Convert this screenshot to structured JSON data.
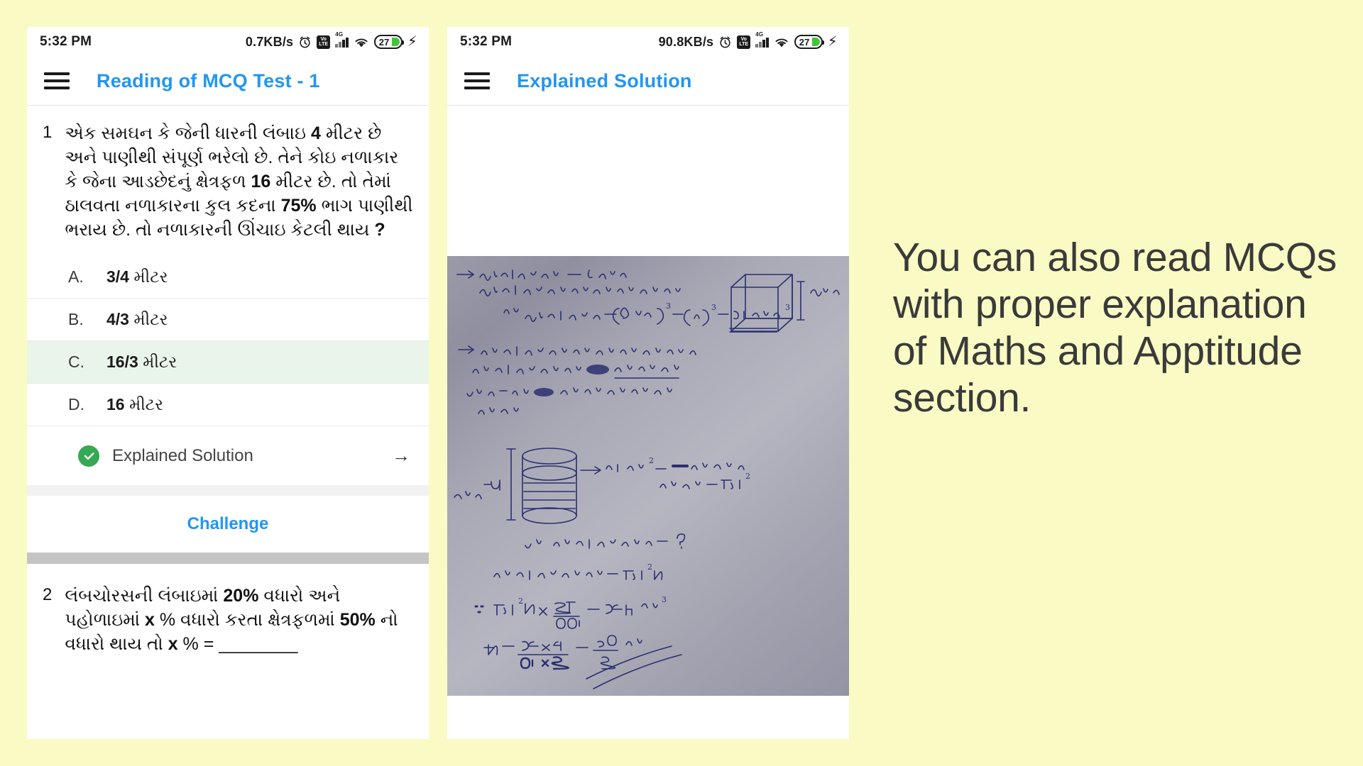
{
  "background_color": "#FAFAC4",
  "accent_color": "#2196F3",
  "correct_color": "#34A853",
  "marketing": {
    "text": "You can also read MCQs with proper explanation of Maths and Apptitude section."
  },
  "phone_left": {
    "status_bar": {
      "time": "5:32 PM",
      "network_speed": "0.7KB/s",
      "icons": [
        "alarm-icon",
        "volte-icon",
        "signal-4g-icon",
        "wifi-icon",
        "battery-icon",
        "charging-bolt-icon"
      ],
      "volte_label_top": "Vo",
      "volte_label_bottom": "LTE",
      "network_type": "4G",
      "battery_percent": "27"
    },
    "app_bar": {
      "menu_icon": "hamburger-menu-icon",
      "title": "Reading of MCQ Test - 1"
    },
    "questions": [
      {
        "number": "1",
        "text_html": "એક સમઘન કે જેની ધારની લંબાઇ <b>4</b> મીટર છે અને પાણીથી સંપૂર્ણ ભરેલો છે. તેને કોઇ નળાકાર કે જેના આડછેદનું ક્ષેત્રફળ <b>16</b> મીટર છે. તો તેમાં ઠાલવતા નળાકારના કુલ કદના <b>75%</b> ભાગ પાણીથી ભરાય છે. તો નળાકારની ઊંચાઇ કેટલી થાય <b>?</b>",
        "options": [
          {
            "label": "A.",
            "value": "3/4",
            "unit": "મીટર",
            "correct": false
          },
          {
            "label": "B.",
            "value": "4/3",
            "unit": "મીટર",
            "correct": false
          },
          {
            "label": "C.",
            "value": "16/3",
            "unit": "મીટર",
            "correct": true
          },
          {
            "label": "D.",
            "value": "16",
            "unit": "મીટર",
            "correct": false
          }
        ],
        "solution_row": {
          "status_icon": "check-circle-icon",
          "label": "Explained Solution",
          "chevron_icon": "arrow-right-icon"
        },
        "challenge_label": "Challenge"
      },
      {
        "number": "2",
        "text_html": "લંબચોરસની લંબાઇમાં <b>20%</b> વધારો અને પહોળાઇમાં <b>x</b> % વધારો કરતા ક્ષેત્રફળમાં <b>50%</b> નો વધારો થાય તો <b>x</b> % = ________"
      }
    ]
  },
  "phone_right": {
    "status_bar": {
      "time": "5:32 PM",
      "network_speed": "90.8KB/s",
      "icons": [
        "alarm-icon",
        "volte-icon",
        "signal-4g-icon",
        "wifi-icon",
        "battery-icon",
        "charging-bolt-icon"
      ],
      "volte_label_top": "Vo",
      "volte_label_bottom": "LTE",
      "network_type": "4G",
      "battery_percent": "27"
    },
    "app_bar": {
      "menu_icon": "hamburger-menu-icon",
      "title": "Explained Solution"
    },
    "handwritten_solution": {
      "description": "Handwritten Gujarati maths working on grey paper",
      "lines": [
        "→ સમઘનની ધારની લંબાઇ = ૪ મીટર",
        "અને સમઘન માં સંપૂર્ણ પાણીથી ભરેલ છે,",
        "તો સમઘનનું ઘનફળ = (લંબાઇ)³ = (૪)³ = ૬૪ મીટર³",
        "→ હવે આ પાણીને એક નળાકાર આકારના પાત્રમાં",
        "ઠાલવવામાં આવે છે. તેમાં પાણી કુલ કદનાં",
        "75% જેટલું ભરાય છે અને બાકીનો ભાગ ખાલી રહે છે.",
        "→ 16 મી² = આડછેદનું ક્ષેત્રફળ = πr²",
        "તો નળાકારની ઊંચાઇ = ?",
        "નળાકારનું ઘનફળ = πr²h",
        "∴ πr²h × 75/100 = 64 મી³",
        "h = 64×4 / 16×3 = 16/3 મી"
      ],
      "diagram_labels": [
        "cube-diagram",
        "cylinder-diagram",
        "૪ મીટર",
        "h",
        "(ઊંચાઇ)"
      ]
    }
  }
}
